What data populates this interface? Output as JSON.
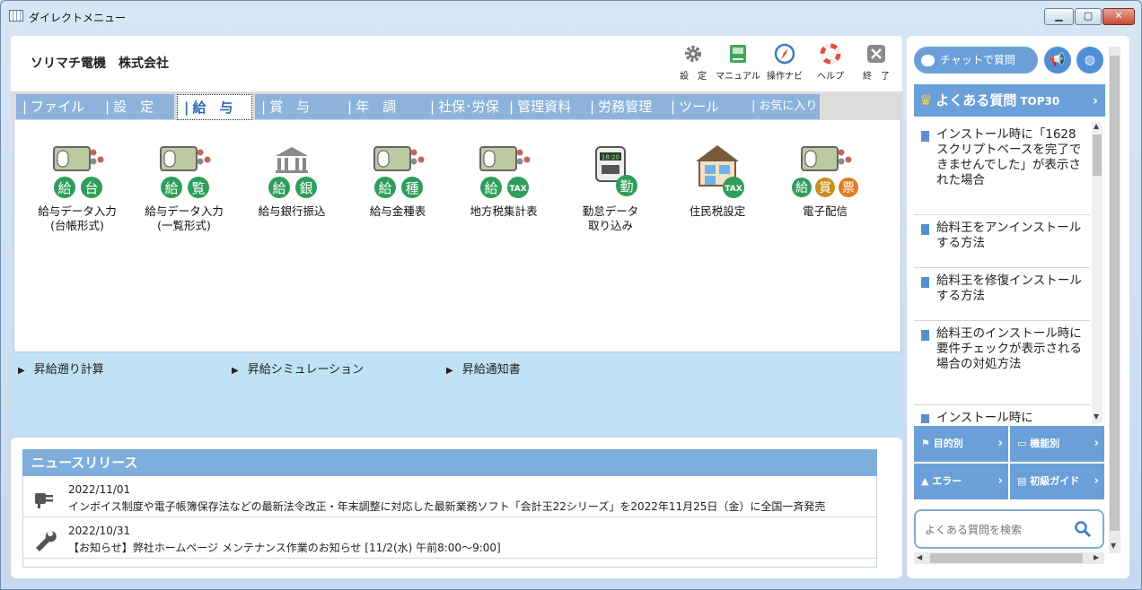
{
  "window": {
    "title": "ダイレクトメニュー",
    "min": "▁",
    "max": "▢",
    "close": "✕"
  },
  "header": {
    "company": "ソリマチ電機　株式会社",
    "tools": [
      {
        "label": "設　定",
        "icon": "gear-icon"
      },
      {
        "label": "マニュアル",
        "icon": "manual-icon"
      },
      {
        "label": "操作ナビ",
        "icon": "compass-icon"
      },
      {
        "label": "ヘルプ",
        "icon": "lifebuoy-icon"
      },
      {
        "label": "終　了",
        "icon": "close-icon"
      }
    ]
  },
  "tabs": [
    {
      "label": "ファイル"
    },
    {
      "label": "設　定"
    },
    {
      "label": "給　与",
      "active": true
    },
    {
      "label": "賞　与"
    },
    {
      "label": "年　調"
    },
    {
      "label": "社保･労保"
    },
    {
      "label": "管理資料"
    },
    {
      "label": "労務管理"
    },
    {
      "label": "ツール"
    },
    {
      "label": "お気に入り"
    }
  ],
  "functions": [
    {
      "line1": "給与データ入力",
      "line2": "(台帳形式)",
      "badges": [
        "給",
        "台"
      ]
    },
    {
      "line1": "給与データ入力",
      "line2": "(一覧形式)",
      "badges": [
        "給",
        "覧"
      ]
    },
    {
      "line1": "給与銀行振込",
      "line2": "",
      "badges": [
        "給",
        "銀"
      ]
    },
    {
      "line1": "給与金種表",
      "line2": "",
      "badges": [
        "給",
        "種"
      ]
    },
    {
      "line1": "地方税集計表",
      "line2": "",
      "badges": [
        "給",
        "TAX"
      ]
    },
    {
      "line1": "勤怠データ",
      "line2": "取り込み",
      "badges": [
        "勤"
      ],
      "clock": "18:20"
    },
    {
      "line1": "住民税設定",
      "line2": "",
      "badges": [
        "TAX"
      ]
    },
    {
      "line1": "電子配信",
      "line2": "",
      "badges": [
        "給",
        "賞",
        "票"
      ]
    }
  ],
  "sub_links": [
    {
      "label": "昇給遡り計算"
    },
    {
      "label": "昇給シミュレーション"
    },
    {
      "label": "昇給通知書"
    }
  ],
  "news": {
    "title": "ニュースリリース",
    "items": [
      {
        "date": "2022/11/01",
        "text": "インボイス制度や電子帳簿保存法などの最新法令改正・年末調整に対応した最新業務ソフト「会計王22シリーズ」を2022年11月25日（金）に全国一斉発売",
        "icon": "plug-icon"
      },
      {
        "date": "2022/10/31",
        "text": "【お知らせ】弊社ホームページ メンテナンス作業のお知らせ [11/2(水) 午前8:00～9:00]",
        "icon": "wrench-icon"
      }
    ]
  },
  "side": {
    "chat_label": "チャットで質問",
    "faq_title": "よくある質問",
    "faq_top": "TOP30",
    "faq_items": [
      "インストール時に「1628　スクリプトベースを完了できませんでした」が表示された場合",
      "給料王をアンインストールする方法",
      "給料王を修復インストールする方法",
      "給料王のインストール時に要件チェックが表示される場合の対処方法",
      "インストール時に"
    ],
    "categories": [
      {
        "label": "目的別",
        "icon": "flag-icon"
      },
      {
        "label": "機能別",
        "icon": "monitor-icon"
      },
      {
        "label": "エラー",
        "icon": "warning-icon"
      },
      {
        "label": "初級ガイド",
        "icon": "guide-icon"
      }
    ],
    "search_placeholder": "よくある質問を検索"
  },
  "colors": {
    "tab_blue": "#8db3dc",
    "active_text": "#2a6cb5",
    "badge_green": "#2e9e5a",
    "badge_orange": "#e37a1e",
    "sub_panel": "#bfe2f6",
    "accent": "#6b9fd8"
  }
}
